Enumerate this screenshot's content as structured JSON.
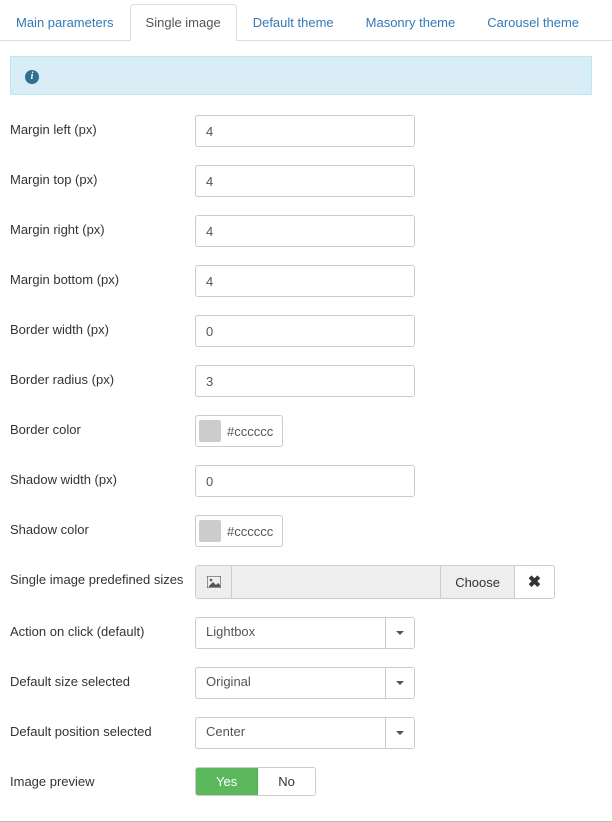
{
  "tabs": {
    "main_parameters": "Main parameters",
    "single_image": "Single image",
    "default_theme": "Default theme",
    "masonry_theme": "Masonry theme",
    "carousel_theme": "Carousel theme"
  },
  "labels": {
    "margin_left": "Margin left (px)",
    "margin_top": "Margin top (px)",
    "margin_right": "Margin right (px)",
    "margin_bottom": "Margin bottom (px)",
    "border_width": "Border width (px)",
    "border_radius": "Border radius (px)",
    "border_color": "Border color",
    "shadow_width": "Shadow width (px)",
    "shadow_color": "Shadow color",
    "predefined_sizes": "Single image predefined sizes",
    "action_on_click": "Action on click (default)",
    "default_size": "Default size selected",
    "default_position": "Default position selected",
    "image_preview": "Image preview"
  },
  "values": {
    "margin_left": "4",
    "margin_top": "4",
    "margin_right": "4",
    "margin_bottom": "4",
    "border_width": "0",
    "border_radius": "3",
    "border_color": "#cccccc",
    "shadow_width": "0",
    "shadow_color": "#cccccc",
    "choose_label": "Choose",
    "action_on_click": "Lightbox",
    "default_size": "Original",
    "default_position": "Center",
    "yes": "Yes",
    "no": "No"
  }
}
